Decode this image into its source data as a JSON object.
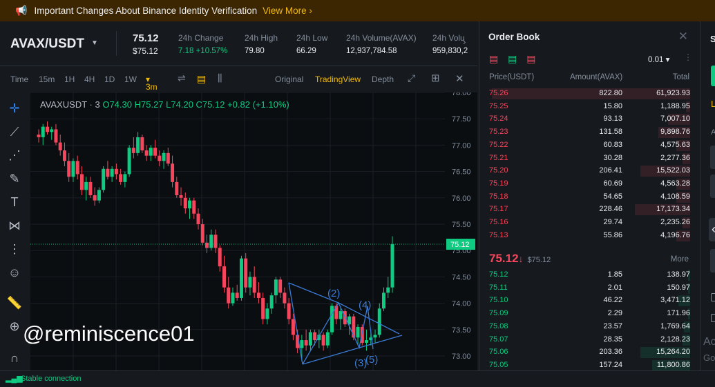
{
  "banner": {
    "title": "Important Changes About Binance Identity Verification",
    "link": "View More"
  },
  "ticker": {
    "pair": "AVAX/USDT",
    "price": "75.12",
    "price_usd": "$75.12",
    "stats": [
      {
        "label": "24h Change",
        "value": "7.18 +10.57%",
        "color": "green"
      },
      {
        "label": "24h High",
        "value": "79.80",
        "color": "white"
      },
      {
        "label": "24h Low",
        "value": "66.29",
        "color": "white"
      },
      {
        "label": "24h Volume(AVAX)",
        "value": "12,937,784.58",
        "color": "white"
      },
      {
        "label": "24h Volu",
        "value": "959,830,2",
        "color": "white"
      }
    ]
  },
  "toolbar": {
    "time_label": "Time",
    "intervals": [
      "15m",
      "1H",
      "4H",
      "1D",
      "1W"
    ],
    "active_interval": "3m",
    "views": [
      "Original",
      "TradingView",
      "Depth"
    ],
    "active_view": "TradingView"
  },
  "chart": {
    "legend_symbol": "AVAXUSDT · 3",
    "legend_o": "O74.30",
    "legend_h": "H75.27",
    "legend_l": "L74.20",
    "legend_c": "C75.12",
    "legend_chg": "+0.82 (+1.10%)",
    "price_label": "75.12",
    "wave_labels": [
      "(2)",
      "(4)",
      "(3)",
      "(5)"
    ],
    "watermark": "@reminiscence01"
  },
  "chart_data": {
    "type": "candlestick",
    "y_ticks": [
      "78.00",
      "77.50",
      "77.00",
      "76.50",
      "76.00",
      "75.50",
      "75.00",
      "74.50",
      "74.00",
      "73.50",
      "73.00"
    ],
    "ylim": [
      72.8,
      78.0
    ],
    "current_price": 75.12,
    "candles": [
      [
        77.2,
        77.3,
        77.05,
        77.15
      ],
      [
        77.15,
        77.4,
        77.0,
        77.35
      ],
      [
        77.35,
        77.45,
        77.2,
        77.25
      ],
      [
        77.25,
        77.35,
        77.1,
        77.3
      ],
      [
        77.3,
        77.4,
        77.0,
        77.05
      ],
      [
        77.05,
        77.2,
        76.8,
        76.9
      ],
      [
        76.9,
        77.05,
        76.6,
        76.7
      ],
      [
        76.7,
        76.85,
        76.3,
        76.4
      ],
      [
        76.4,
        76.75,
        76.3,
        76.7
      ],
      [
        76.7,
        76.8,
        76.35,
        76.45
      ],
      [
        76.45,
        76.6,
        76.05,
        76.15
      ],
      [
        76.15,
        76.4,
        75.95,
        76.3
      ],
      [
        76.3,
        76.4,
        76.0,
        76.05
      ],
      [
        76.05,
        76.2,
        75.85,
        75.95
      ],
      [
        75.95,
        76.2,
        75.9,
        76.15
      ],
      [
        76.15,
        76.6,
        76.1,
        76.55
      ],
      [
        76.55,
        76.7,
        76.35,
        76.4
      ],
      [
        76.4,
        76.6,
        76.3,
        76.55
      ],
      [
        76.55,
        76.65,
        76.35,
        76.45
      ],
      [
        76.45,
        76.55,
        76.25,
        76.3
      ],
      [
        76.3,
        76.5,
        76.2,
        76.45
      ],
      [
        76.45,
        77.0,
        76.4,
        76.95
      ],
      [
        76.95,
        77.15,
        76.75,
        76.85
      ],
      [
        76.85,
        77.25,
        76.8,
        77.15
      ],
      [
        77.15,
        77.2,
        76.85,
        76.9
      ],
      [
        76.9,
        77.0,
        76.7,
        76.8
      ],
      [
        76.8,
        77.0,
        76.7,
        76.95
      ],
      [
        76.95,
        77.1,
        76.75,
        76.8
      ],
      [
        76.8,
        76.9,
        76.6,
        76.7
      ],
      [
        76.7,
        76.9,
        76.55,
        76.85
      ],
      [
        76.85,
        76.95,
        76.6,
        76.65
      ],
      [
        76.65,
        76.8,
        76.2,
        76.3
      ],
      [
        76.3,
        76.4,
        76.0,
        76.05
      ],
      [
        76.05,
        76.2,
        75.85,
        76.0
      ],
      [
        76.0,
        76.1,
        75.7,
        75.8
      ],
      [
        75.8,
        76.0,
        75.6,
        75.95
      ],
      [
        75.95,
        76.0,
        75.6,
        75.7
      ],
      [
        75.7,
        75.8,
        75.4,
        75.5
      ],
      [
        75.5,
        75.6,
        75.1,
        75.15
      ],
      [
        75.15,
        75.3,
        74.95,
        75.05
      ],
      [
        75.05,
        75.4,
        75.0,
        75.3
      ],
      [
        75.3,
        75.4,
        74.95,
        75.05
      ],
      [
        75.05,
        75.1,
        74.6,
        74.7
      ],
      [
        74.7,
        74.9,
        74.2,
        74.3
      ],
      [
        74.3,
        74.5,
        73.9,
        74.0
      ],
      [
        74.0,
        74.3,
        73.95,
        74.2
      ],
      [
        74.2,
        74.35,
        74.05,
        74.1
      ],
      [
        74.1,
        74.9,
        74.05,
        74.85
      ],
      [
        74.85,
        74.95,
        74.2,
        74.3
      ],
      [
        74.3,
        74.6,
        74.15,
        74.5
      ],
      [
        74.5,
        74.7,
        74.1,
        74.2
      ],
      [
        74.2,
        74.4,
        74.0,
        74.1
      ],
      [
        74.1,
        74.2,
        73.6,
        73.7
      ],
      [
        73.7,
        74.0,
        73.6,
        73.9
      ],
      [
        73.9,
        74.2,
        73.8,
        74.15
      ],
      [
        74.15,
        74.5,
        74.0,
        74.45
      ],
      [
        74.45,
        74.5,
        74.1,
        74.2
      ],
      [
        74.2,
        74.3,
        73.9,
        74.0
      ],
      [
        74.0,
        74.1,
        73.6,
        73.7
      ],
      [
        73.7,
        73.8,
        73.3,
        73.4
      ],
      [
        73.4,
        73.5,
        73.05,
        73.15
      ],
      [
        73.15,
        73.4,
        72.9,
        73.3
      ],
      [
        73.3,
        73.5,
        73.1,
        73.2
      ],
      [
        73.2,
        73.5,
        73.1,
        73.45
      ],
      [
        73.45,
        73.5,
        73.2,
        73.3
      ],
      [
        73.3,
        73.5,
        73.15,
        73.4
      ],
      [
        73.4,
        73.45,
        73.1,
        73.2
      ],
      [
        73.2,
        73.5,
        73.15,
        73.45
      ],
      [
        73.45,
        74.0,
        73.4,
        73.95
      ],
      [
        73.95,
        74.0,
        73.6,
        73.7
      ],
      [
        73.7,
        73.9,
        73.5,
        73.85
      ],
      [
        73.85,
        73.9,
        73.55,
        73.6
      ],
      [
        73.6,
        73.8,
        73.4,
        73.75
      ],
      [
        73.75,
        73.8,
        73.3,
        73.35
      ],
      [
        73.35,
        73.6,
        73.2,
        73.55
      ],
      [
        73.55,
        73.6,
        73.2,
        73.25
      ],
      [
        73.25,
        73.5,
        73.1,
        73.3
      ],
      [
        73.3,
        73.5,
        73.2,
        73.35
      ],
      [
        73.35,
        73.5,
        73.25,
        73.4
      ],
      [
        73.4,
        74.0,
        73.35,
        73.9
      ],
      [
        73.9,
        74.3,
        73.85,
        74.2
      ],
      [
        74.2,
        74.5,
        74.1,
        74.3
      ],
      [
        74.3,
        75.27,
        74.2,
        75.12
      ]
    ]
  },
  "orderbook": {
    "title": "Order Book",
    "step": "0.01",
    "headers": {
      "price": "Price(USDT)",
      "amount": "Amount(AVAX)",
      "total": "Total"
    },
    "asks": [
      {
        "price": "75.26",
        "amount": "822.80",
        "total": "61,923.93",
        "depth": 100
      },
      {
        "price": "75.25",
        "amount": "15.80",
        "total": "1,188.95",
        "depth": 2
      },
      {
        "price": "75.24",
        "amount": "93.13",
        "total": "7,007.10",
        "depth": 11
      },
      {
        "price": "75.23",
        "amount": "131.58",
        "total": "9,898.76",
        "depth": 16
      },
      {
        "price": "75.22",
        "amount": "60.83",
        "total": "4,575.63",
        "depth": 7
      },
      {
        "price": "75.21",
        "amount": "30.28",
        "total": "2,277.36",
        "depth": 4
      },
      {
        "price": "75.20",
        "amount": "206.41",
        "total": "15,522.03",
        "depth": 25
      },
      {
        "price": "75.19",
        "amount": "60.69",
        "total": "4,563.28",
        "depth": 7
      },
      {
        "price": "75.18",
        "amount": "54.65",
        "total": "4,108.59",
        "depth": 7
      },
      {
        "price": "75.17",
        "amount": "228.46",
        "total": "17,173.34",
        "depth": 28
      },
      {
        "price": "75.16",
        "amount": "29.74",
        "total": "2,235.26",
        "depth": 4
      },
      {
        "price": "75.13",
        "amount": "55.86",
        "total": "4,196.76",
        "depth": 7
      }
    ],
    "mid_price": "75.12",
    "mid_arrow": "↓",
    "mid_usd": "$75.12",
    "more": "More",
    "bids": [
      {
        "price": "75.12",
        "amount": "1.85",
        "total": "138.97",
        "depth": 1
      },
      {
        "price": "75.11",
        "amount": "2.01",
        "total": "150.97",
        "depth": 1
      },
      {
        "price": "75.10",
        "amount": "46.22",
        "total": "3,471.12",
        "depth": 6
      },
      {
        "price": "75.09",
        "amount": "2.29",
        "total": "171.96",
        "depth": 1
      },
      {
        "price": "75.08",
        "amount": "23.57",
        "total": "1,769.64",
        "depth": 3
      },
      {
        "price": "75.07",
        "amount": "28.35",
        "total": "2,128.23",
        "depth": 4
      },
      {
        "price": "75.06",
        "amount": "203.36",
        "total": "15,264.20",
        "depth": 25
      },
      {
        "price": "75.05",
        "amount": "157.24",
        "total": "11,800.86",
        "depth": 19
      }
    ]
  },
  "rightpanel": {
    "s": "S",
    "l": "L",
    "a": "A",
    "act": "Act",
    "go": "Go"
  },
  "status": {
    "text": "Stable connection"
  }
}
